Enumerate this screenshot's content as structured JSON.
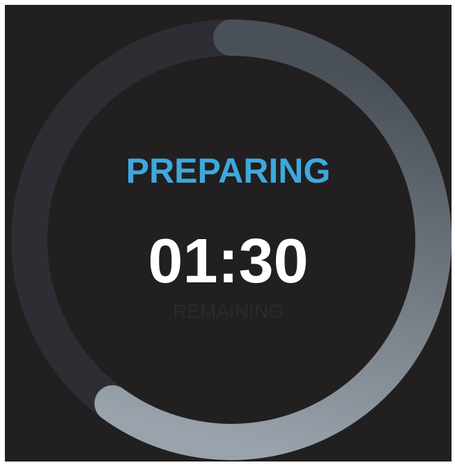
{
  "timer": {
    "status": "PREPARING",
    "time": "01:30",
    "sublabel": "REMAINING",
    "progress_fraction": 0.6
  },
  "colors": {
    "background": "#221f20",
    "status": "#3ea8dc",
    "time": "#ffffff",
    "sublabel": "#2c2a2c",
    "track": "#2d2e33",
    "progress_start": "#4a5058",
    "progress_end": "#9aa3ac"
  }
}
